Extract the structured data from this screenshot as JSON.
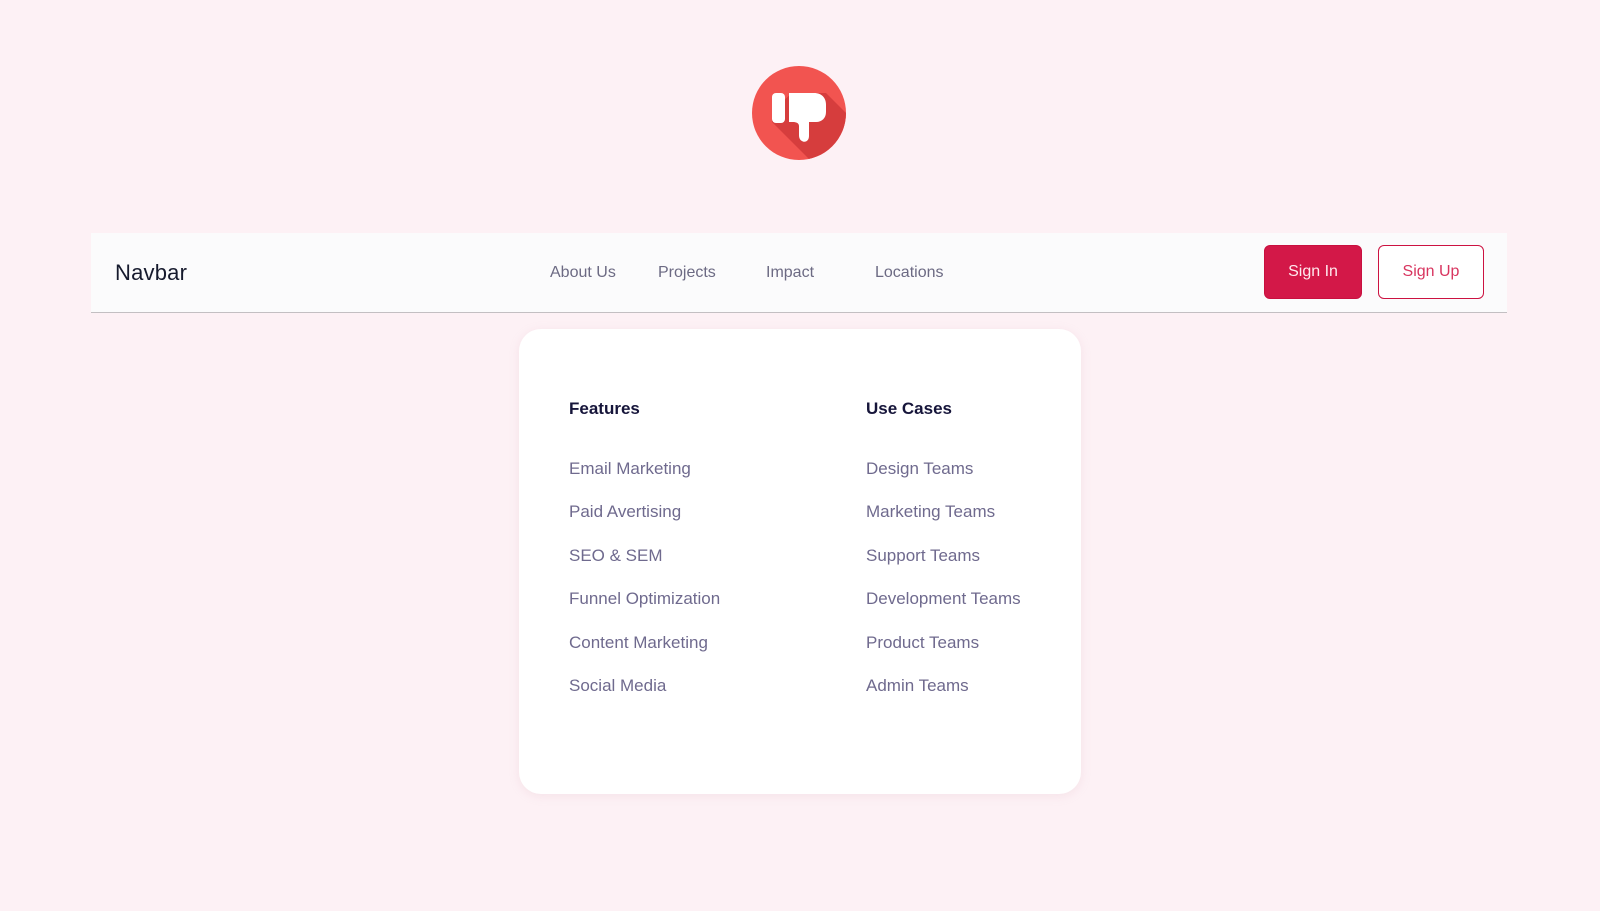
{
  "logo": {
    "icon": "thumbs-down-icon",
    "colors": {
      "badge": "#f25450",
      "shadow": "#d63d3d",
      "glyph": "#ffffff"
    }
  },
  "navbar": {
    "brand": "Navbar",
    "links": [
      {
        "label": "About Us"
      },
      {
        "label": "Projects"
      },
      {
        "label": "Impact"
      },
      {
        "label": "Locations"
      }
    ],
    "sign_in_label": "Sign In",
    "sign_up_label": "Sign Up",
    "accent_color": "#d31848"
  },
  "dropdown": {
    "columns": [
      {
        "title": "Features",
        "items": [
          "Email Marketing",
          "Paid Avertising",
          "SEO & SEM",
          "Funnel Optimization",
          "Content Marketing",
          "Social Media"
        ]
      },
      {
        "title": "Use Cases",
        "items": [
          "Design Teams",
          "Marketing Teams",
          "Support Teams",
          "Development Teams",
          "Product Teams",
          "Admin Teams"
        ]
      }
    ]
  }
}
